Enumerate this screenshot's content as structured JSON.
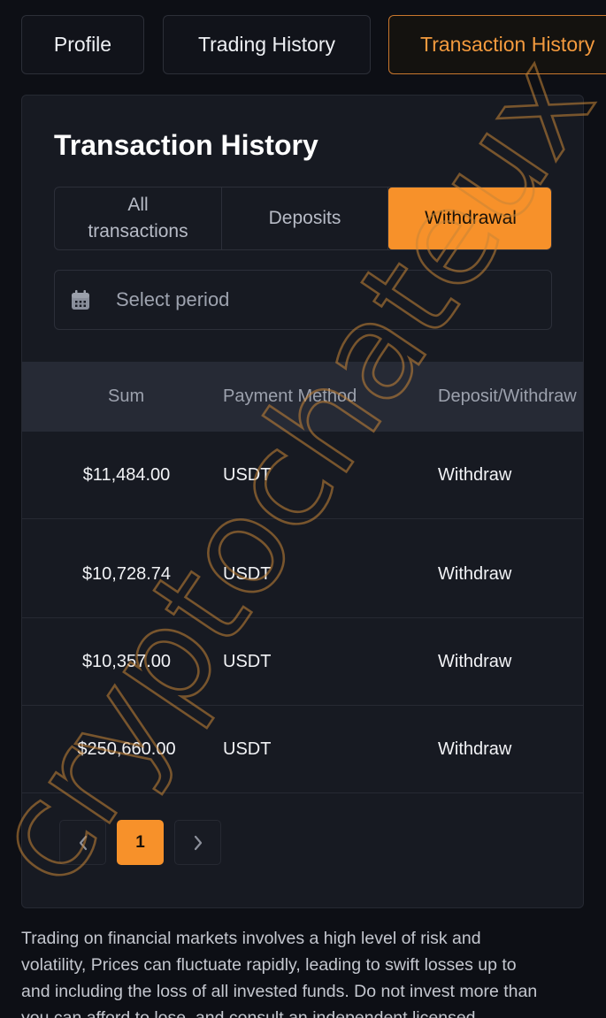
{
  "top_tabs": {
    "profile": "Profile",
    "trading_history": "Trading History",
    "transaction_history": "Transaction History"
  },
  "card": {
    "title": "Transaction History",
    "filters": {
      "all_line1": "All",
      "all_line2": "transactions",
      "deposits": "Deposits",
      "withdrawal": "Withdrawal"
    },
    "period": {
      "icon": "calendar-icon",
      "placeholder": "Select period"
    }
  },
  "table": {
    "headers": {
      "sum": "Sum",
      "payment_method": "Payment Method",
      "deposit_withdraw": "Deposit/Withdraw"
    },
    "rows": [
      {
        "sum": "$11,484.00",
        "method": "USDT",
        "type": "Withdraw"
      },
      {
        "sum": "$10,728.74",
        "method": "USDT",
        "type": "Withdraw"
      },
      {
        "sum": "$10,357.00",
        "method": "USDT",
        "type": "Withdraw"
      },
      {
        "sum": "$250,660.00",
        "method": "USDT",
        "type": "Withdraw"
      }
    ]
  },
  "pagination": {
    "current_page": "1",
    "prev_icon": "chevron-left-icon",
    "next_icon": "chevron-right-icon"
  },
  "disclaimer": {
    "line1": "Trading on financial markets involves a high level of risk and",
    "line2": "volatility, Prices can fluctuate rapidly, leading to swift losses up to",
    "line3": "and including the loss of all invested funds. Do not invest more than",
    "line4": "you can afford to lose, and consult an independent licensed"
  },
  "watermark": {
    "text": "cryptochateux"
  },
  "colors": {
    "background": "#0d0f15",
    "card": "#171a22",
    "accent": "#f7912a",
    "accent_text": "#f39a3e",
    "table_header": "#262a35"
  }
}
